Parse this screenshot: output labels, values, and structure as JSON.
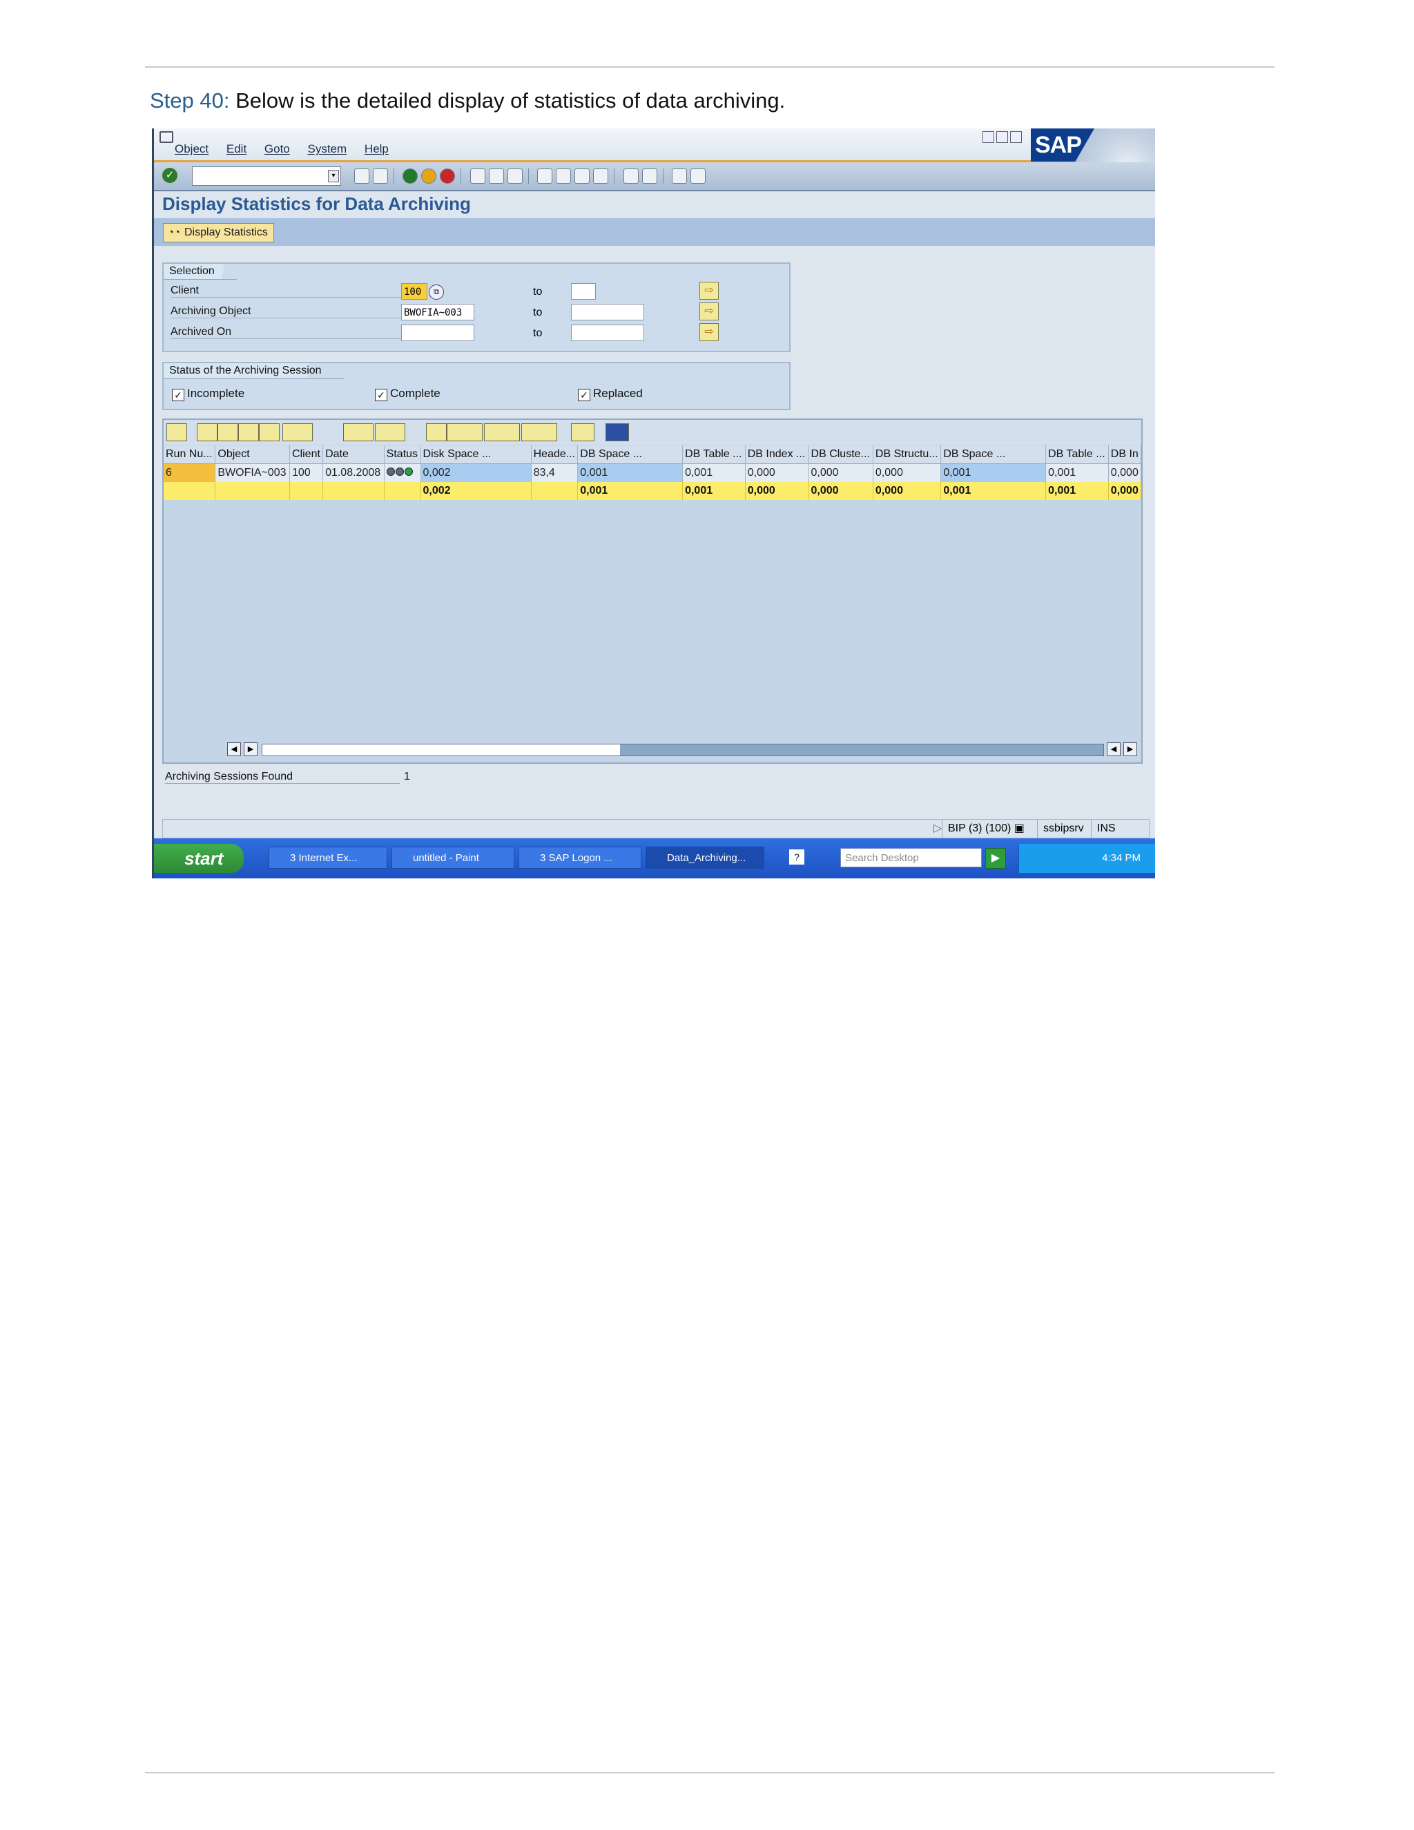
{
  "doc": {
    "step_lead": "Step 40:",
    "step_text": " Below is the detailed display of statistics of data archiving."
  },
  "sap": {
    "menu": [
      "Object",
      "Edit",
      "Goto",
      "System",
      "Help"
    ],
    "logo": "SAP",
    "title": "Display Statistics for Data Archiving",
    "display_button": "Display Statistics",
    "selection": {
      "title": "Selection",
      "client_label": "Client",
      "client_value": "100",
      "object_label": "Archiving Object",
      "object_value": "BWOFIA~003",
      "archived_label": "Archived On",
      "to_label": "to"
    },
    "status_group": {
      "title": "Status of the Archiving Session",
      "incomplete": "Incomplete",
      "complete": "Complete",
      "replaced": "Replaced"
    },
    "table": {
      "headers": [
        "Run Nu...",
        "Object",
        "Client",
        "Date",
        "Status",
        "Disk Space ...",
        "Heade...",
        "DB Space ...",
        "DB Table ...",
        "DB Index ...",
        "DB Cluste...",
        "DB Structu...",
        "DB Space ...",
        "DB Table ...",
        "DB In"
      ],
      "row": [
        "6",
        "BWOFIA~003",
        "100",
        "01.08.2008",
        "",
        "0,002",
        "83,4",
        "0,001",
        "0,001",
        "0,000",
        "0,000",
        "0,000",
        "0,001",
        "0,001",
        "0,000"
      ],
      "total": [
        "",
        "",
        "",
        "",
        "",
        "0,002",
        "",
        "0,001",
        "0,001",
        "0,000",
        "0,000",
        "0,000",
        "0,001",
        "0,001",
        "0,000"
      ]
    },
    "found_label": "Archiving Sessions Found",
    "found_value": "1",
    "status_bar": {
      "system": "BIP (3) (100)",
      "server": "ssbipsrv",
      "mode": "INS"
    }
  },
  "taskbar": {
    "start": "start",
    "tasks": [
      "3 Internet Ex...",
      "untitled - Paint",
      "3 SAP Logon ...",
      "Data_Archiving..."
    ],
    "search_placeholder": "Search Desktop",
    "clock": "4:34 PM"
  }
}
